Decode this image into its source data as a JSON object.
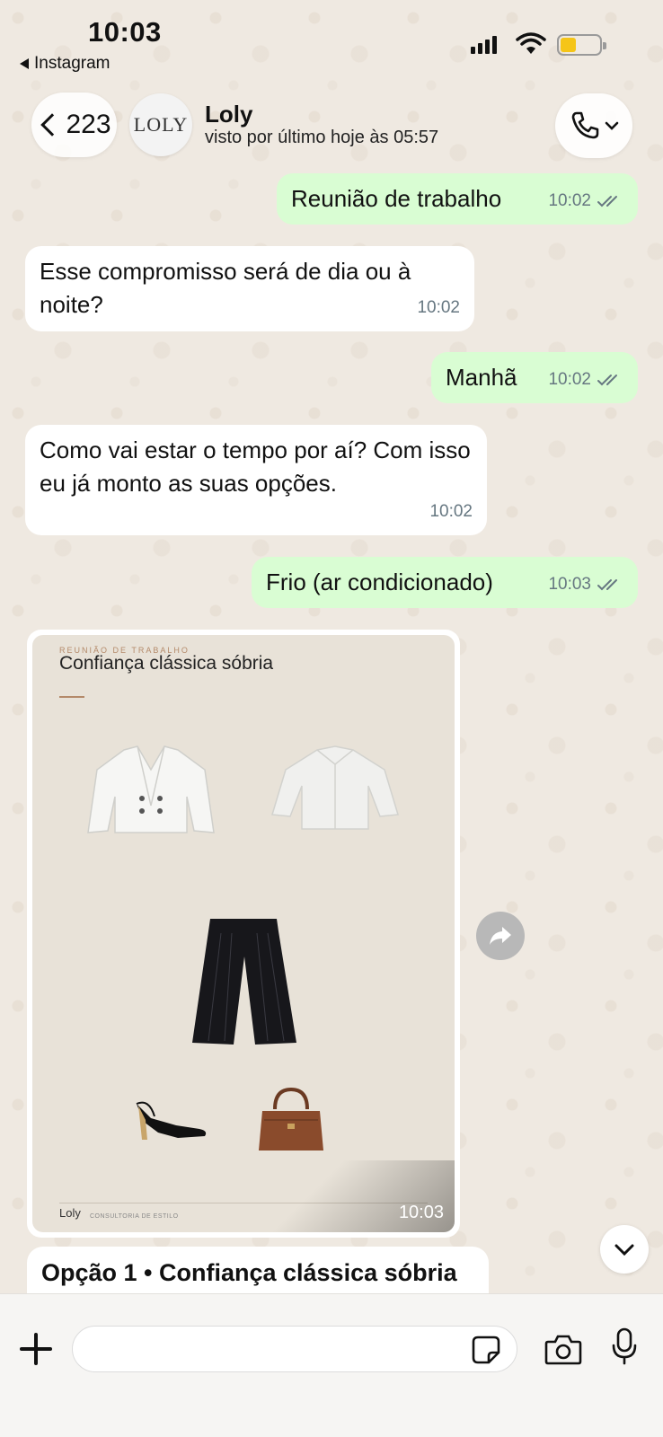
{
  "status_bar": {
    "time": "10:03",
    "back_app": "Instagram"
  },
  "header": {
    "back_count": "223",
    "avatar_logo": "LOLY",
    "contact_name": "Loly",
    "contact_status": "visto por último hoje às 05:57"
  },
  "messages": [
    {
      "direction": "out",
      "text": "Reunião de trabalho",
      "time": "10:02",
      "read": true
    },
    {
      "direction": "in",
      "text": "Esse compromisso será de dia ou à noite?",
      "time": "10:02"
    },
    {
      "direction": "out",
      "text": "Manhã",
      "time": "10:02",
      "read": true
    },
    {
      "direction": "in",
      "text": "Como vai estar o tempo por aí? Com isso eu já monto as suas opções.",
      "time": "10:02"
    },
    {
      "direction": "out",
      "text": "Frio (ar condicionado)",
      "time": "10:03",
      "read": true
    }
  ],
  "image_message": {
    "kicker": "REUNIÃO DE TRABALHO",
    "title": "Confiança clássica sóbria",
    "brand": "Loly",
    "brand_sub": "CONSULTORIA DE ESTILO",
    "time": "10:03",
    "items": [
      "blazer",
      "shirt",
      "trousers",
      "heels",
      "handbag"
    ]
  },
  "caption": {
    "text": "Opção 1 • Confiança clássica sóbria"
  },
  "composer": {
    "placeholder": ""
  },
  "colors": {
    "outgoing": "#d9fdd3",
    "incoming": "#ffffff",
    "background": "#efeae2",
    "meta": "#667781"
  }
}
